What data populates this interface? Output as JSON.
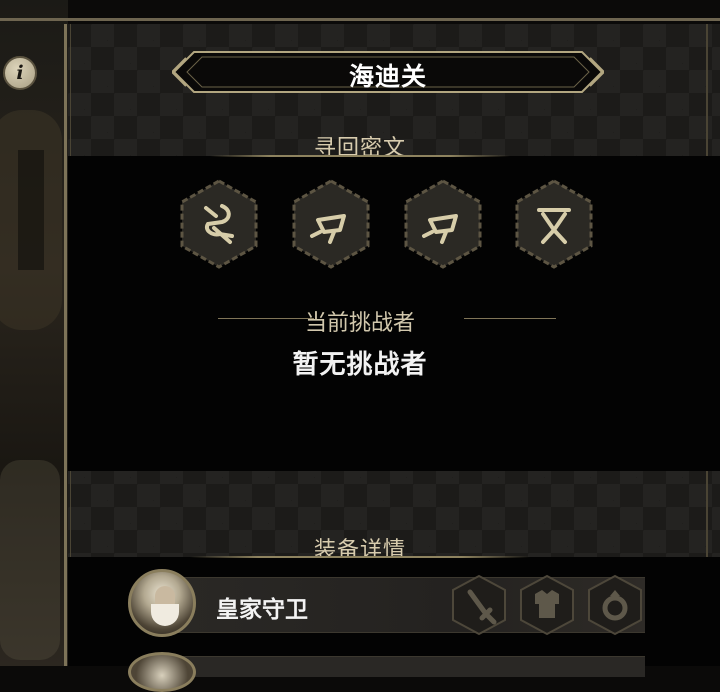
{
  "header": {
    "title": "海迪关",
    "info_icon": "i"
  },
  "runes": {
    "section_title": "寻回密文",
    "items": [
      {
        "name": "rune-1-icon"
      },
      {
        "name": "rune-2-icon"
      },
      {
        "name": "rune-3-icon"
      },
      {
        "name": "rune-4-icon"
      }
    ]
  },
  "challenger": {
    "label": "当前挑战者",
    "value": "暂无挑战者"
  },
  "equipment": {
    "section_title": "装备详情",
    "rows": [
      {
        "name": "皇家守卫",
        "slots": [
          "sword-icon",
          "armor-icon",
          "ring-icon"
        ]
      }
    ]
  },
  "colors": {
    "accent_gold": "#8e835f",
    "panel_bg": "#1c1b19",
    "text_light": "#f2f2f2"
  }
}
